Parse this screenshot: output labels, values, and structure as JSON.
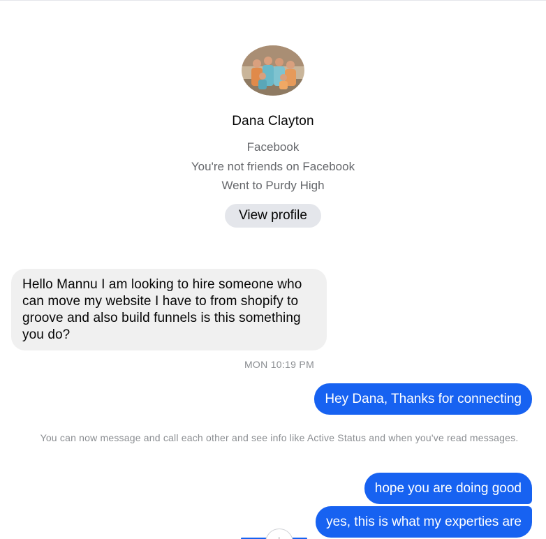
{
  "contact": {
    "name": "Dana Clayton",
    "meta_lines": [
      "Facebook",
      "You're not friends on Facebook",
      "Went to Purdy High"
    ],
    "view_profile_label": "View profile",
    "avatar_icon": "group-photo-avatar"
  },
  "messages": {
    "incoming_1": "Hello Mannu I am looking to hire someone who can move my website I have to from shopify to groove and also build funnels is this something you do?",
    "timestamp_1": "MON 10:19 PM",
    "outgoing_1": "Hey Dana, Thanks for connecting",
    "system_notice": "You can now message and call each other and see info like Active Status and when you've read messages.",
    "outgoing_2": "hope you are doing good",
    "outgoing_3": "yes, this is what my experties are"
  },
  "scroll_down_icon": "arrow-down-icon",
  "colors": {
    "outgoing_bubble": "#1762f1",
    "incoming_bubble": "#f0f0f0",
    "secondary_text": "#65676b",
    "button_bg": "#e4e6eb"
  }
}
